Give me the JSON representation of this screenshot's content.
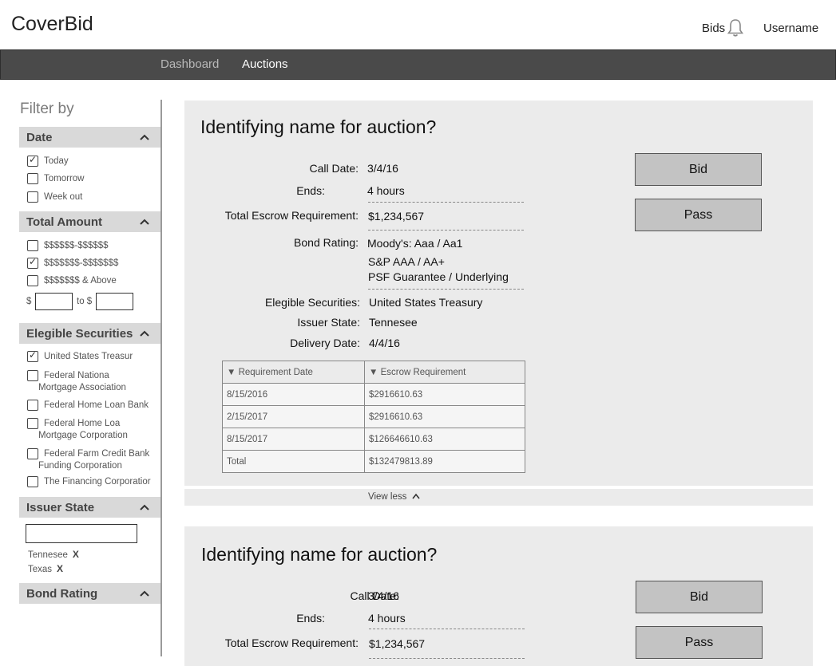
{
  "header": {
    "brand": "CoverBid",
    "bids_label": "Bids",
    "username": "Username"
  },
  "nav": {
    "items": [
      "Dashboard",
      "Auctions"
    ],
    "active": "Auctions"
  },
  "sidebar": {
    "filter_title": "Filter by",
    "date": {
      "title": "Date",
      "options": [
        {
          "label": "Today",
          "checked": true
        },
        {
          "label": "Tomorrow",
          "checked": false
        },
        {
          "label": "Week out",
          "checked": false
        }
      ]
    },
    "total_amount": {
      "title": "Total Amount",
      "options": [
        {
          "label": "$$$$$$-$$$$$$",
          "checked": false
        },
        {
          "label": "$$$$$$$-$$$$$$$",
          "checked": true
        },
        {
          "label": "$$$$$$$ & Above",
          "checked": false
        }
      ],
      "from_label": "$",
      "to_label": "to $",
      "from_value": "",
      "to_value": ""
    },
    "securities": {
      "title": "Elegible Securities",
      "options": [
        {
          "label": "United States Treasur",
          "checked": true
        },
        {
          "label": "Federal Nationa",
          "label2": "Mortgage Association",
          "checked": false
        },
        {
          "label": "Federal Home Loan Bank",
          "checked": false
        },
        {
          "label": "Federal Home Loa",
          "label2": "Mortgage Corporation",
          "checked": false
        },
        {
          "label": "Federal Farm Credit Bank",
          "label2": "Funding Corporation",
          "checked": false
        },
        {
          "label": "The Financing Corporatior",
          "checked": false
        }
      ]
    },
    "issuer_state": {
      "title": "Issuer State",
      "input_value": "",
      "tags": [
        "Tennesee",
        "Texas"
      ],
      "remove_glyph": "X"
    },
    "bond_rating": {
      "title": "Bond Rating"
    }
  },
  "auctions": [
    {
      "title": "Identifying name for auction?",
      "call_date_label": "Call Date:",
      "call_date": "3/4/16",
      "ends_label": "Ends:",
      "ends": "4 hours",
      "escrow_label": "Total Escrow Requirement:",
      "escrow": "$1,234,567",
      "rating_label": "Bond Rating:",
      "ratings": [
        "Moody's: Aaa / Aa1",
        "S&P AAA / AA+",
        "PSF Guarantee / Underlying"
      ],
      "securities_label": "Elegible Securities:",
      "securities": "United States Treasury",
      "issuer_label": "Issuer State:",
      "issuer": "Tennesee",
      "delivery_label": "Delivery Date:",
      "delivery": "4/4/16",
      "table": {
        "headers": [
          "Requirement Date",
          "Escrow Requirement"
        ],
        "rows": [
          [
            "8/15/2016",
            "$2916610.63"
          ],
          [
            "2/15/2017",
            "$2916610.63"
          ],
          [
            "8/15/2017",
            "$126646610.63"
          ],
          [
            "Total",
            "$132479813.89"
          ]
        ]
      },
      "bid_label": "Bid",
      "pass_label": "Pass",
      "view_less": "View less"
    },
    {
      "title": "Identifying name for auction?",
      "call_date_label": "Call Date:",
      "call_date": "3/4/16",
      "ends_label": "Ends:",
      "ends": "4 hours",
      "escrow_label": "Total Escrow Requirement:",
      "escrow": "$1,234,567",
      "bid_label": "Bid",
      "pass_label": "Pass"
    }
  ],
  "icons": {
    "bell": "bell-icon",
    "chevron": "chevron-up-icon",
    "sort": "sort-down-icon",
    "check": "check-icon"
  },
  "colors": {
    "navbar": "#4a4a4a",
    "section_header": "#d9d9d9",
    "card_bg": "#ebebeb",
    "button": "#c3c3c3"
  }
}
